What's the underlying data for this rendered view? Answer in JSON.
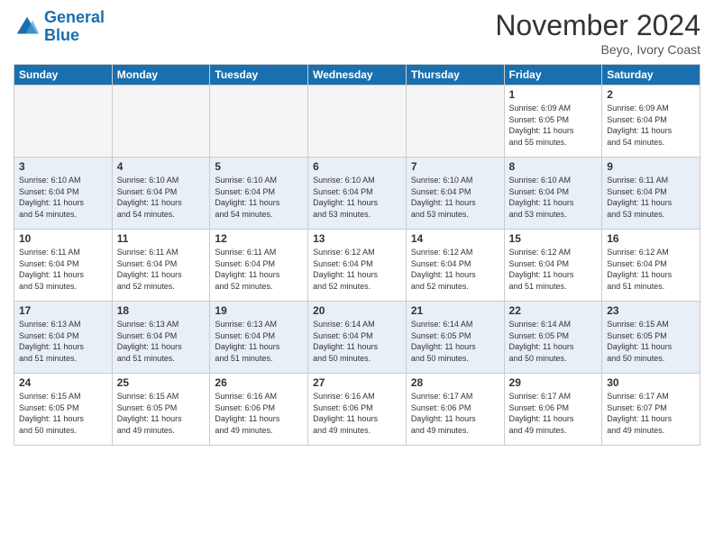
{
  "header": {
    "logo_line1": "General",
    "logo_line2": "Blue",
    "month": "November 2024",
    "location": "Beyo, Ivory Coast"
  },
  "days_of_week": [
    "Sunday",
    "Monday",
    "Tuesday",
    "Wednesday",
    "Thursday",
    "Friday",
    "Saturday"
  ],
  "weeks": [
    [
      {
        "num": "",
        "info": ""
      },
      {
        "num": "",
        "info": ""
      },
      {
        "num": "",
        "info": ""
      },
      {
        "num": "",
        "info": ""
      },
      {
        "num": "",
        "info": ""
      },
      {
        "num": "1",
        "info": "Sunrise: 6:09 AM\nSunset: 6:05 PM\nDaylight: 11 hours\nand 55 minutes."
      },
      {
        "num": "2",
        "info": "Sunrise: 6:09 AM\nSunset: 6:04 PM\nDaylight: 11 hours\nand 54 minutes."
      }
    ],
    [
      {
        "num": "3",
        "info": "Sunrise: 6:10 AM\nSunset: 6:04 PM\nDaylight: 11 hours\nand 54 minutes."
      },
      {
        "num": "4",
        "info": "Sunrise: 6:10 AM\nSunset: 6:04 PM\nDaylight: 11 hours\nand 54 minutes."
      },
      {
        "num": "5",
        "info": "Sunrise: 6:10 AM\nSunset: 6:04 PM\nDaylight: 11 hours\nand 54 minutes."
      },
      {
        "num": "6",
        "info": "Sunrise: 6:10 AM\nSunset: 6:04 PM\nDaylight: 11 hours\nand 53 minutes."
      },
      {
        "num": "7",
        "info": "Sunrise: 6:10 AM\nSunset: 6:04 PM\nDaylight: 11 hours\nand 53 minutes."
      },
      {
        "num": "8",
        "info": "Sunrise: 6:10 AM\nSunset: 6:04 PM\nDaylight: 11 hours\nand 53 minutes."
      },
      {
        "num": "9",
        "info": "Sunrise: 6:11 AM\nSunset: 6:04 PM\nDaylight: 11 hours\nand 53 minutes."
      }
    ],
    [
      {
        "num": "10",
        "info": "Sunrise: 6:11 AM\nSunset: 6:04 PM\nDaylight: 11 hours\nand 53 minutes."
      },
      {
        "num": "11",
        "info": "Sunrise: 6:11 AM\nSunset: 6:04 PM\nDaylight: 11 hours\nand 52 minutes."
      },
      {
        "num": "12",
        "info": "Sunrise: 6:11 AM\nSunset: 6:04 PM\nDaylight: 11 hours\nand 52 minutes."
      },
      {
        "num": "13",
        "info": "Sunrise: 6:12 AM\nSunset: 6:04 PM\nDaylight: 11 hours\nand 52 minutes."
      },
      {
        "num": "14",
        "info": "Sunrise: 6:12 AM\nSunset: 6:04 PM\nDaylight: 11 hours\nand 52 minutes."
      },
      {
        "num": "15",
        "info": "Sunrise: 6:12 AM\nSunset: 6:04 PM\nDaylight: 11 hours\nand 51 minutes."
      },
      {
        "num": "16",
        "info": "Sunrise: 6:12 AM\nSunset: 6:04 PM\nDaylight: 11 hours\nand 51 minutes."
      }
    ],
    [
      {
        "num": "17",
        "info": "Sunrise: 6:13 AM\nSunset: 6:04 PM\nDaylight: 11 hours\nand 51 minutes."
      },
      {
        "num": "18",
        "info": "Sunrise: 6:13 AM\nSunset: 6:04 PM\nDaylight: 11 hours\nand 51 minutes."
      },
      {
        "num": "19",
        "info": "Sunrise: 6:13 AM\nSunset: 6:04 PM\nDaylight: 11 hours\nand 51 minutes."
      },
      {
        "num": "20",
        "info": "Sunrise: 6:14 AM\nSunset: 6:04 PM\nDaylight: 11 hours\nand 50 minutes."
      },
      {
        "num": "21",
        "info": "Sunrise: 6:14 AM\nSunset: 6:05 PM\nDaylight: 11 hours\nand 50 minutes."
      },
      {
        "num": "22",
        "info": "Sunrise: 6:14 AM\nSunset: 6:05 PM\nDaylight: 11 hours\nand 50 minutes."
      },
      {
        "num": "23",
        "info": "Sunrise: 6:15 AM\nSunset: 6:05 PM\nDaylight: 11 hours\nand 50 minutes."
      }
    ],
    [
      {
        "num": "24",
        "info": "Sunrise: 6:15 AM\nSunset: 6:05 PM\nDaylight: 11 hours\nand 50 minutes."
      },
      {
        "num": "25",
        "info": "Sunrise: 6:15 AM\nSunset: 6:05 PM\nDaylight: 11 hours\nand 49 minutes."
      },
      {
        "num": "26",
        "info": "Sunrise: 6:16 AM\nSunset: 6:06 PM\nDaylight: 11 hours\nand 49 minutes."
      },
      {
        "num": "27",
        "info": "Sunrise: 6:16 AM\nSunset: 6:06 PM\nDaylight: 11 hours\nand 49 minutes."
      },
      {
        "num": "28",
        "info": "Sunrise: 6:17 AM\nSunset: 6:06 PM\nDaylight: 11 hours\nand 49 minutes."
      },
      {
        "num": "29",
        "info": "Sunrise: 6:17 AM\nSunset: 6:06 PM\nDaylight: 11 hours\nand 49 minutes."
      },
      {
        "num": "30",
        "info": "Sunrise: 6:17 AM\nSunset: 6:07 PM\nDaylight: 11 hours\nand 49 minutes."
      }
    ]
  ]
}
